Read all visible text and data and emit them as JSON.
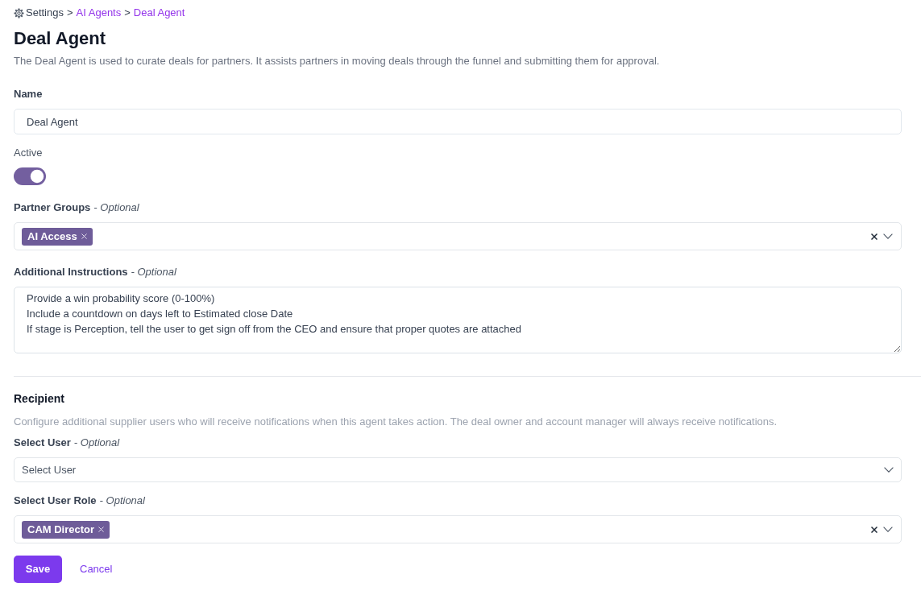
{
  "breadcrumb": {
    "items": [
      {
        "label": "Settings",
        "link": false
      },
      {
        "label": "AI Agents",
        "link": true
      },
      {
        "label": "Deal Agent",
        "link": true
      }
    ],
    "separators": [
      ">",
      ">"
    ]
  },
  "page": {
    "title": "Deal Agent",
    "description": "The Deal Agent is used to curate deals for partners. It assists partners in moving deals through the funnel and submitting them for approval."
  },
  "fields": [
    {
      "kind": "text",
      "label": "Name",
      "value": "Deal Agent"
    },
    {
      "kind": "toggle",
      "label": "Active",
      "on": true
    },
    {
      "kind": "multiselect",
      "label": "Partner Groups",
      "note": "- Optional",
      "tags": [
        {
          "label": "AI Access"
        }
      ]
    },
    {
      "kind": "textarea",
      "label": "Additional Instructions",
      "note": "- Optional",
      "value": "Provide a win probability score (0-100%)\nInclude a countdown on days left to Estimated close Date\nIf stage is Perception, tell the user to get sign off from the CEO and ensure that proper quotes are attached"
    }
  ],
  "recipient": {
    "title": "Recipient",
    "description": "Configure additional supplier users who will receive notifications when this agent takes action. The deal owner and account manager will always receive notifications.",
    "fields": [
      {
        "kind": "select",
        "label": "Select User",
        "note": "- Optional",
        "placeholder": "Select User"
      },
      {
        "kind": "multiselect",
        "label": "Select User Role",
        "note": "- Optional",
        "tags": [
          {
            "label": "CAM Director"
          }
        ]
      }
    ]
  },
  "actions": [
    {
      "kind": "primary",
      "label": "Save"
    },
    {
      "kind": "link",
      "label": "Cancel"
    }
  ]
}
